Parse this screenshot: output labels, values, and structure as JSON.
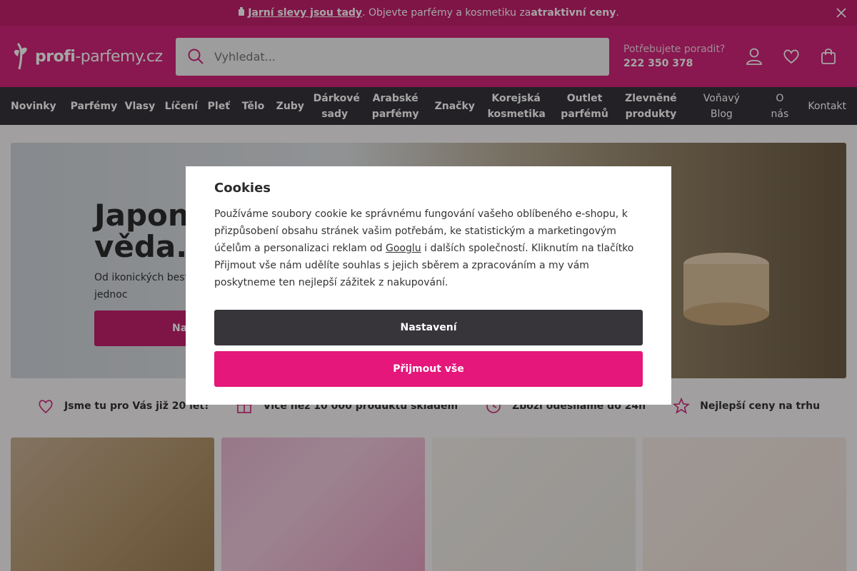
{
  "promo": {
    "icon": "perfume-bottle-icon",
    "link": "Jarní slevy jsou tady",
    "text": ". Objevte parfémy a kosmetiku za ",
    "bold": "atraktivní ceny",
    "end": "."
  },
  "header": {
    "logo_strong": "profi",
    "logo_rest": "-parfemy.cz",
    "search_placeholder": "Vyhledat...",
    "help_label": "Potřebujete poradit?",
    "help_phone": "222 350 378",
    "icons": [
      "user-icon",
      "heart-icon",
      "bag-icon"
    ]
  },
  "nav": {
    "items": [
      {
        "label": "Novinky"
      },
      {
        "label": "Parfémy"
      },
      {
        "label": "Vlasy"
      },
      {
        "label": "Líčení"
      },
      {
        "label": "Pleť"
      },
      {
        "label": "Tělo"
      },
      {
        "label": "Zuby"
      },
      {
        "label": "Dárkové sady"
      },
      {
        "label": "Arabské parfémy"
      },
      {
        "label": "Značky"
      },
      {
        "label": "Korejská kosmetika"
      },
      {
        "label": "Outlet parfémů"
      },
      {
        "label": "Zlevněné produkty"
      }
    ],
    "secondary": [
      {
        "label": "Voňavý Blog"
      },
      {
        "label": "O nás"
      },
      {
        "label": "Kontakt"
      }
    ]
  },
  "hero": {
    "title": "Japons\nvěda. N",
    "text": "Od ikonických bests kosmetiky na jednoc",
    "cta": "Na"
  },
  "features": [
    {
      "icon": "heart-icon",
      "label": "Jsme tu pro Vás již 20 let!"
    },
    {
      "icon": "gift-icon",
      "label": "Více než 10 000 produktů skladem"
    },
    {
      "icon": "clock-icon",
      "label": "Zboží odesíláme do 24h"
    },
    {
      "icon": "star-icon",
      "label": "Nejlepší ceny na trhu"
    }
  ],
  "modal": {
    "title": "Cookies",
    "text_1": "Používáme soubory cookie ke správnému fungování vašeho oblíbeného e-shopu, k přizpůsobení obsahu stránek vašim potřebám, ke statistickým a marketingovým účelům a personalizaci reklam od ",
    "link": "Googlu",
    "text_2": " i dalších společností. Kliknutím na tlačítko Přijmout vše nám udělíte souhlas s jejich sběrem a zpracováním a my vám poskytneme ten nejlepší zážitek z nakupování.",
    "settings": "Nastavení",
    "accept": "Přijmout vše"
  },
  "colors": {
    "brand": "#d1267a",
    "accent_button": "#e5177b",
    "dark": "#37343a"
  }
}
